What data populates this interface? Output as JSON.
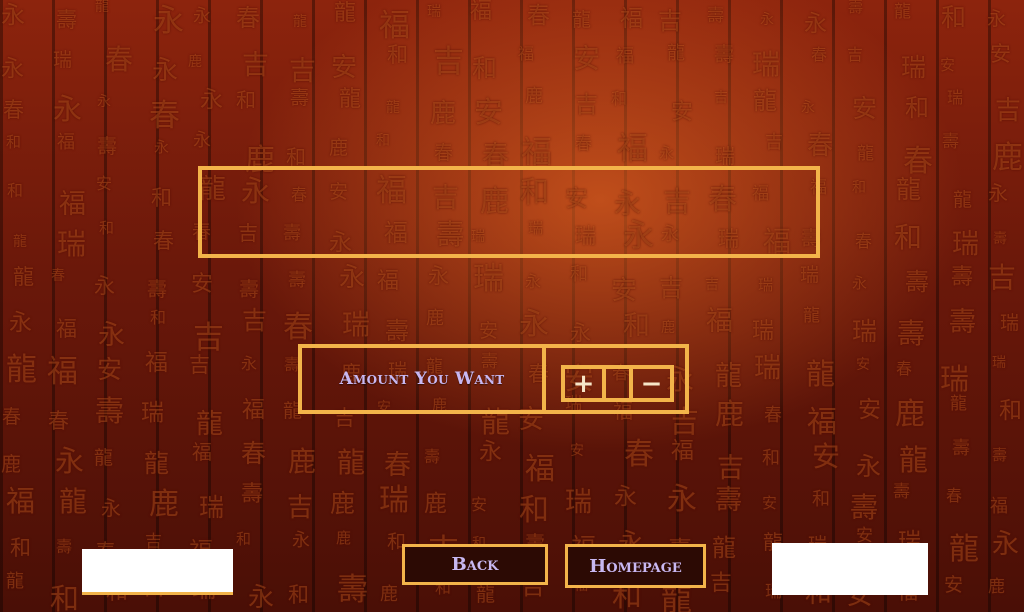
{
  "title_panel": {
    "text": ""
  },
  "amount_panel": {
    "label": "Amount You Want",
    "increment_symbol": "+",
    "decrement_symbol": "−",
    "value": ""
  },
  "nav": {
    "back_label": "Back",
    "homepage_label": "Homepage"
  },
  "colors": {
    "frame": "#f3b44a",
    "label_text": "#c8b8f2",
    "background": "#6a180a"
  },
  "icons": {
    "increment": "plus-icon",
    "decrement": "minus-icon"
  }
}
